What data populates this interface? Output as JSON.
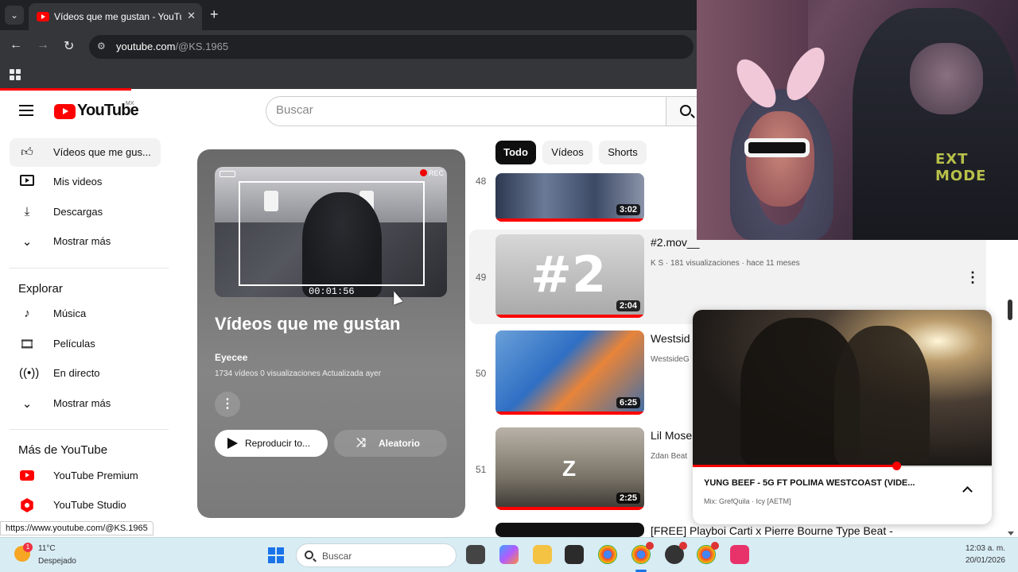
{
  "browser": {
    "tab_title": "Vídeos que me gustan - YouTube",
    "url_host": "youtube.com",
    "url_path": "/@KS.1965",
    "status_url": "https://www.youtube.com/@KS.1965"
  },
  "youtube": {
    "logo_text": "YouTube",
    "country_code": "MX",
    "search_placeholder": "Buscar"
  },
  "sidebar": {
    "items": [
      {
        "label": "Vídeos que me gus...",
        "icon": "thumbs-up-icon"
      },
      {
        "label": "Mis videos",
        "icon": "my-videos-icon"
      },
      {
        "label": "Descargas",
        "icon": "download-icon"
      },
      {
        "label": "Mostrar más",
        "icon": "chevron-down-icon"
      }
    ],
    "explore_title": "Explorar",
    "explore_items": [
      {
        "label": "Música",
        "icon": "music-icon"
      },
      {
        "label": "Películas",
        "icon": "film-icon"
      },
      {
        "label": "En directo",
        "icon": "live-icon"
      },
      {
        "label": "Mostrar más",
        "icon": "chevron-down-icon"
      }
    ],
    "more_title": "Más de YouTube",
    "more_items": [
      {
        "label": "YouTube Premium",
        "icon": "youtube-premium-icon"
      },
      {
        "label": "YouTube Studio",
        "icon": "youtube-studio-icon"
      }
    ]
  },
  "playlist": {
    "title": "Vídeos que me gustan",
    "owner": "Eyecee",
    "meta": "1734 vídeos   0 visualizaciones   Actualizada ayer",
    "thumb_timecode": "00:01:56",
    "thumb_rec": "REC",
    "play_label": "Reproducir to...",
    "shuffle_label": "Aleatorio"
  },
  "chips": [
    "Todo",
    "Vídeos",
    "Shorts"
  ],
  "videos": [
    {
      "index": "48",
      "duration": "3:02",
      "title": "",
      "meta": ""
    },
    {
      "index": "49",
      "duration": "2:04",
      "title": "#2.mov__",
      "meta": "K S · 181 visualizaciones · hace 11 meses",
      "thumb_text": "#2"
    },
    {
      "index": "50",
      "duration": "6:25",
      "title": "Westsid",
      "meta": "WestsideG"
    },
    {
      "index": "51",
      "duration": "2:25",
      "title": "Lil Mose",
      "meta": "Zdan Beat",
      "thumb_text": "Z"
    },
    {
      "index": "",
      "duration": "",
      "title": "[FREE] Playboi Carti x Pierre Bourne Type Beat -",
      "meta": ""
    }
  ],
  "webcam": {
    "shirt_text": "EXT MODE"
  },
  "miniplayer": {
    "title": "YUNG BEEF - 5G FT POLIMA WESTCOAST (VIDE...",
    "subtitle": "Mix: GrefQuila · Icy [AETM]",
    "progress": 0.68
  },
  "taskbar": {
    "temperature": "11°C",
    "condition": "Despejado",
    "weather_badge": "1",
    "search_label": "Buscar",
    "time": "12:03 a. m.",
    "date": "20/01/2026"
  },
  "colors": {
    "accent": "#ff0000",
    "chrome_dark": "#202124",
    "taskbar": "#d8ecf4"
  }
}
